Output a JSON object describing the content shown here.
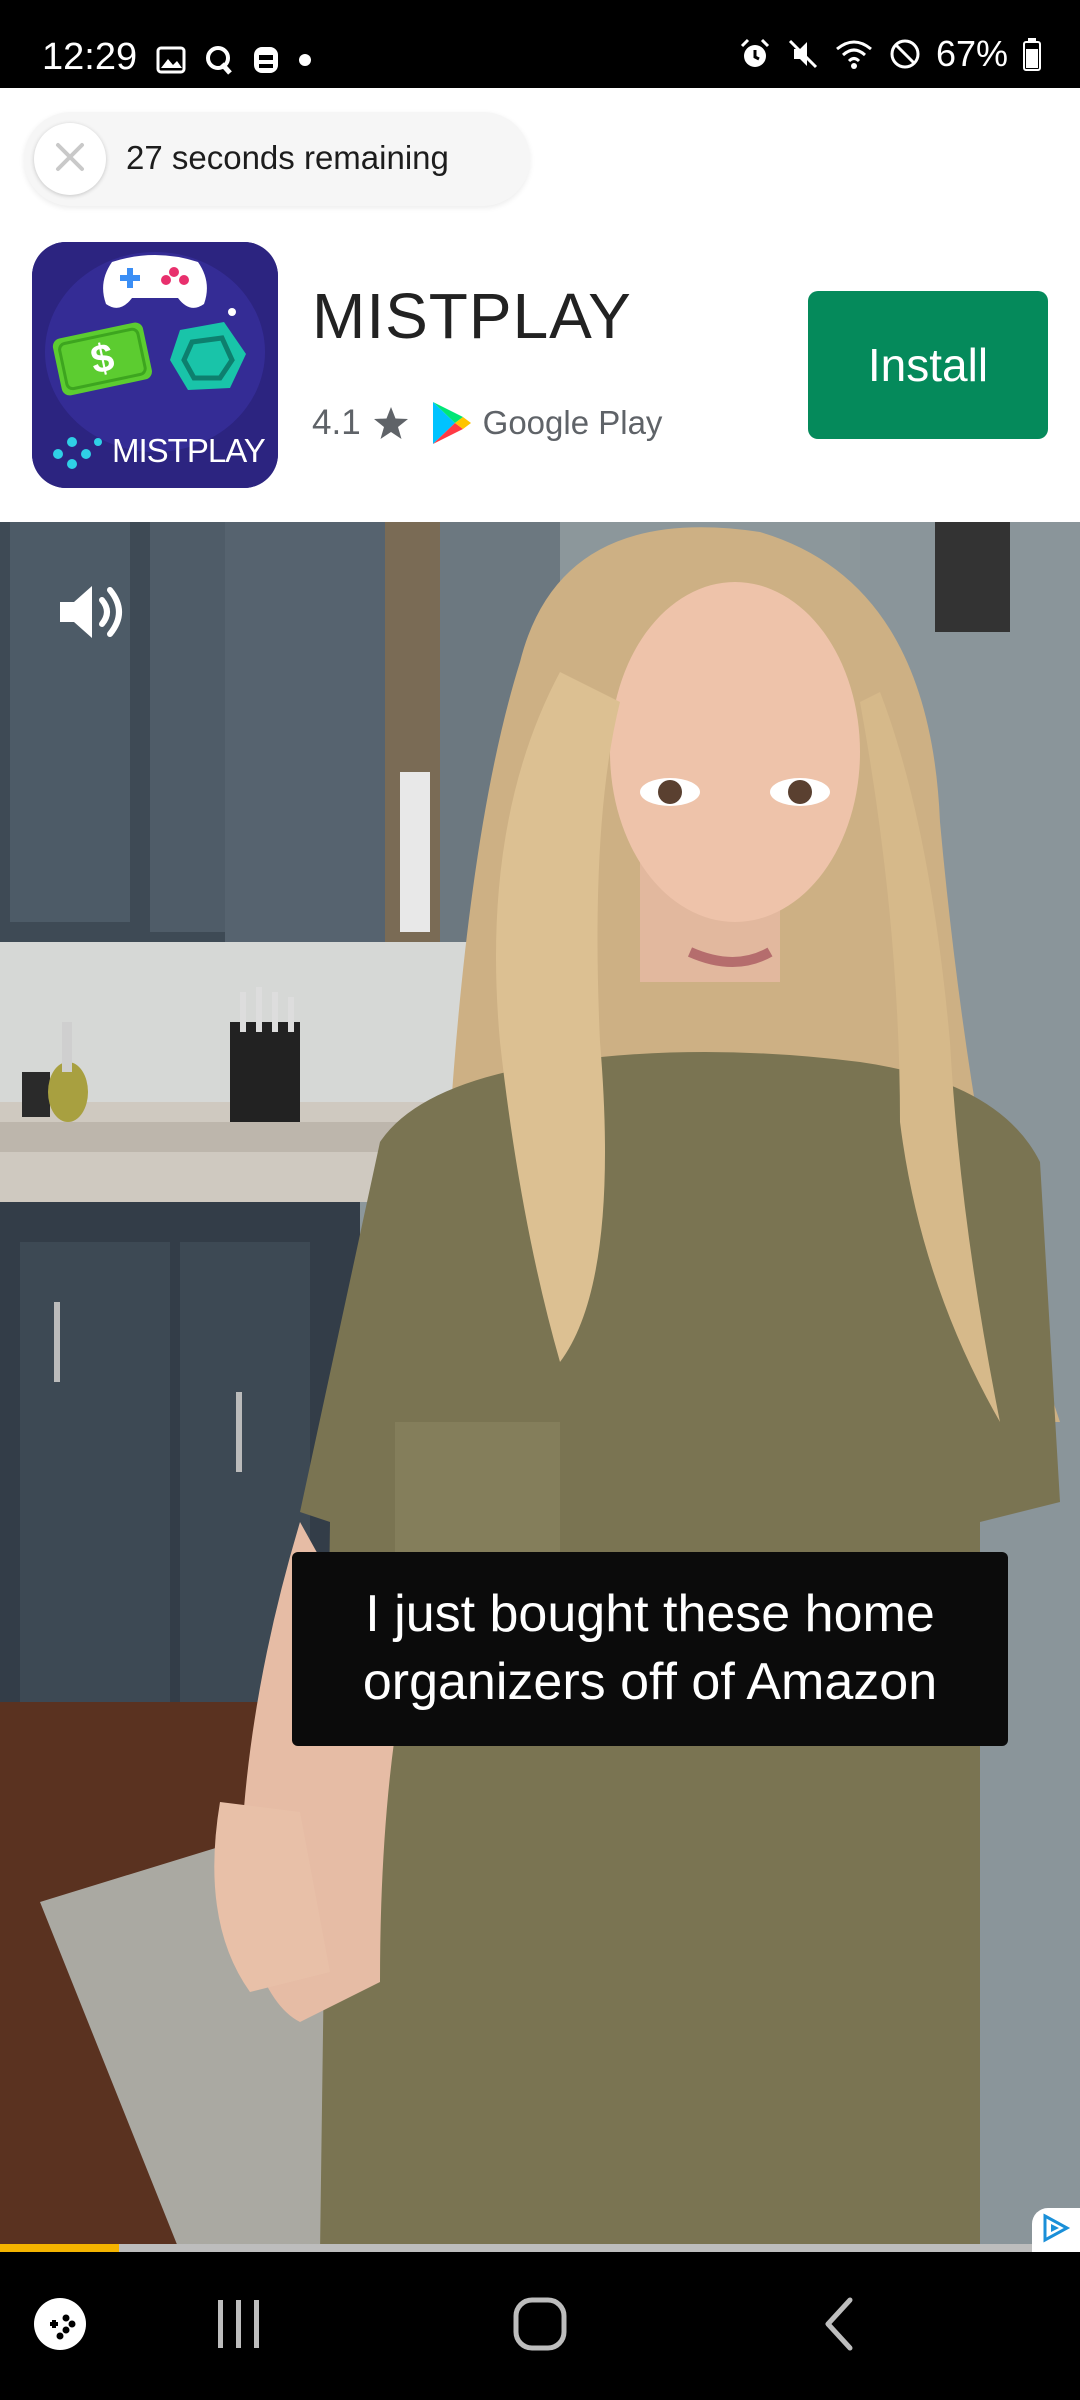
{
  "status_bar": {
    "time": "12:29",
    "battery": "67%",
    "left_icons": [
      "gallery-icon",
      "q-icon",
      "app-icon",
      "dot-icon"
    ],
    "right_icons": [
      "alarm-icon",
      "mute-icon",
      "wifi-icon",
      "no-disturb-icon",
      "battery-icon"
    ]
  },
  "ad": {
    "timer_text": "27 seconds remaining",
    "app_name": "MISTPLAY",
    "app_icon_label": "MISTPLAY",
    "rating": "4.1",
    "store": "Google Play",
    "install_label": "Install",
    "accent_color": "#058a5b"
  },
  "video": {
    "caption": "I just bought these home organizers off of Amazon",
    "progress": 0.11
  },
  "nav_bar": {
    "items": [
      "game-launcher-icon",
      "recents-icon",
      "home-icon",
      "back-icon"
    ]
  }
}
